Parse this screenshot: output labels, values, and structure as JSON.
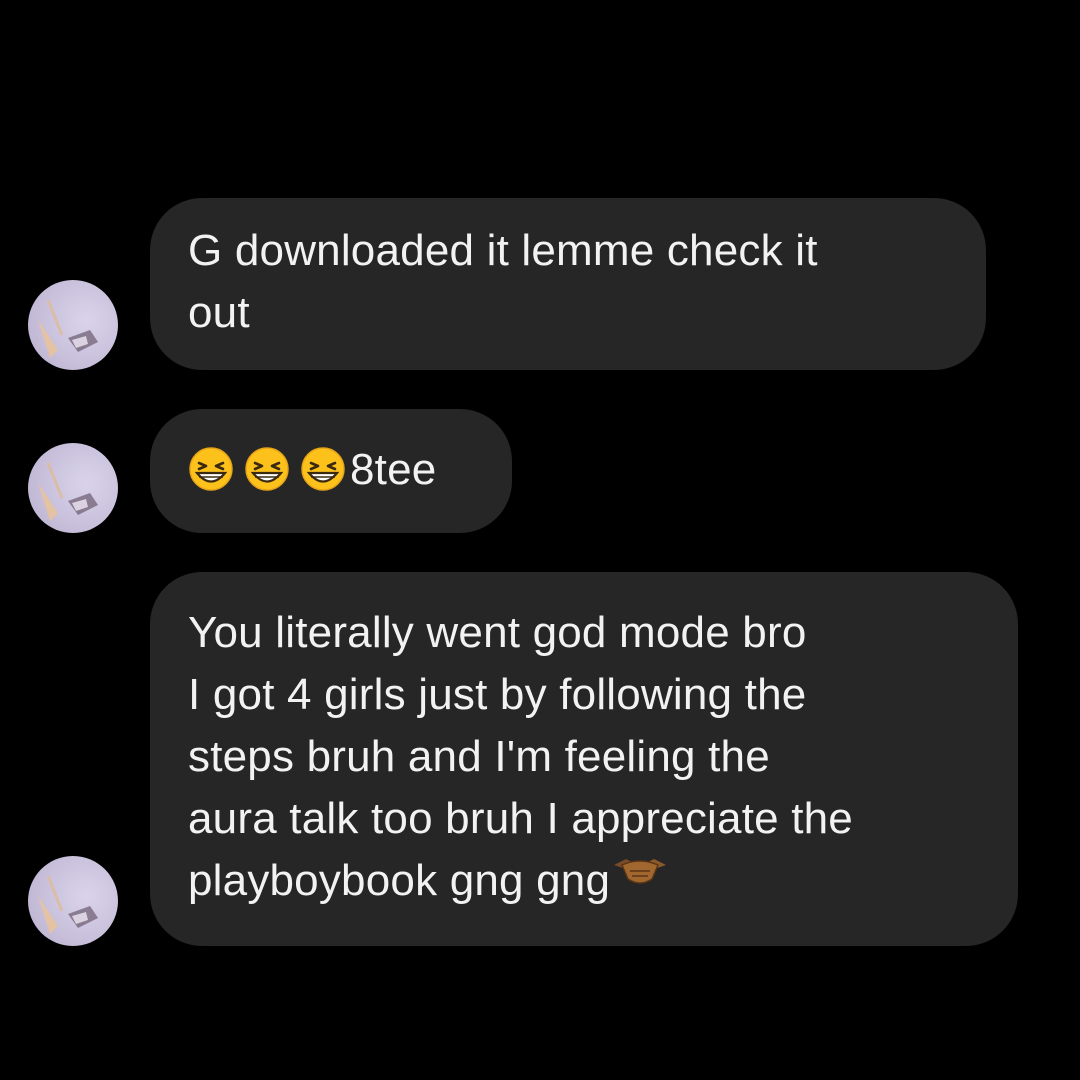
{
  "conversation": {
    "messages": [
      {
        "text": "G downloaded it lemme check it\nout"
      },
      {
        "emoji": [
          "grinning-squinting-face",
          "grinning-squinting-face",
          "grinning-squinting-face"
        ],
        "text": "8tee"
      },
      {
        "text": "You literally went god mode bro\nI got 4 girls just by following the\nsteps bruh and I'm feeling the\naura talk too bruh I appreciate the\nplayboybook gng gng",
        "trailing_emoji": "handshake"
      }
    ]
  },
  "theme": {
    "background": "#000000",
    "bubble": "#262626",
    "text": "#f2f2f2"
  }
}
